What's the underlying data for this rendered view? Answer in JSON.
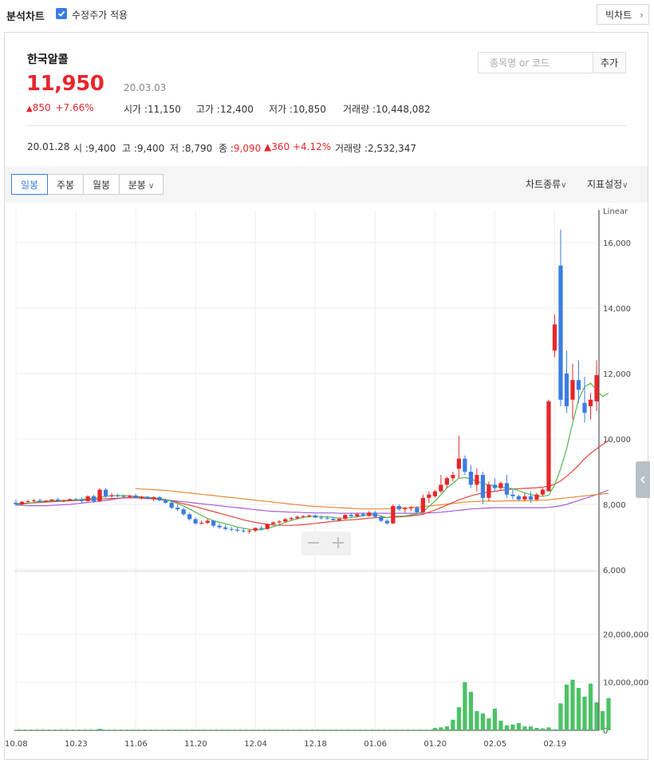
{
  "header": {
    "title": "분석차트",
    "adjusted_label": "수정주가 적용",
    "adjusted_checked": true,
    "big_chart_label": "빅차트"
  },
  "stock": {
    "name": "한국알콜",
    "price": "11,950",
    "date": "20.03.03",
    "change": "850",
    "change_pct": "+7.66%",
    "open_label": "시가 :",
    "open": "11,150",
    "high_label": "고가 :",
    "high": "12,400",
    "low_label": "저가 :",
    "low": "10,850",
    "volume_label": "거래량 :",
    "volume": "10,448,082"
  },
  "search": {
    "placeholder": "종목명 or 코드",
    "add_label": "추가"
  },
  "prev_day": {
    "date": "20.01.28",
    "open_label": "시 :",
    "open": "9,400",
    "high_label": "고 :",
    "high": "9,400",
    "low_label": "저 :",
    "low": "8,790",
    "close_label": "종 :",
    "close": "9,090",
    "change": "360",
    "change_pct": "+4.12%",
    "volume_label": "거래량 :",
    "volume": "2,532,347"
  },
  "toolbar": {
    "periods": [
      "일봉",
      "주봉",
      "월봉",
      "분봉"
    ],
    "chart_type_label": "차트종류",
    "indicator_label": "지표설정"
  },
  "chart_data": {
    "type": "candlestick",
    "scale": "Linear",
    "scale_label": "Linear",
    "price_ticks": [
      "16,000",
      "14,000",
      "12,000",
      "10,000",
      "8,000",
      "6,000"
    ],
    "price_tick_values": [
      16000,
      14000,
      12000,
      10000,
      8000,
      6000
    ],
    "ylim": [
      6000,
      17000
    ],
    "volume_ticks": [
      "20,000,000",
      "10,000,000",
      "0"
    ],
    "volume_tick_values": [
      20000000,
      10000000,
      0
    ],
    "volume_ylim": [
      0,
      31000000
    ],
    "x_ticks": [
      "10.08",
      "10.23",
      "11.06",
      "11.20",
      "12.04",
      "12.18",
      "01.06",
      "01.20",
      "02.05",
      "02.19"
    ],
    "x_tick_index": [
      0,
      10,
      20,
      30,
      40,
      50,
      60,
      70,
      80,
      90
    ],
    "colors": {
      "up": "#e8262b",
      "down": "#3a7de0",
      "volume": "#4cc266",
      "ma5": "#52b84f",
      "ma20": "#e0453c",
      "ma60": "#e98a36",
      "ma120": "#a55ed8"
    },
    "candles": [
      {
        "o": 8050,
        "h": 8150,
        "l": 7950,
        "c": 8000
      },
      {
        "o": 8000,
        "h": 8100,
        "l": 7980,
        "c": 8080
      },
      {
        "o": 8080,
        "h": 8150,
        "l": 8050,
        "c": 8100
      },
      {
        "o": 8100,
        "h": 8160,
        "l": 8080,
        "c": 8120
      },
      {
        "o": 8120,
        "h": 8180,
        "l": 8070,
        "c": 8090
      },
      {
        "o": 8090,
        "h": 8130,
        "l": 8060,
        "c": 8110
      },
      {
        "o": 8110,
        "h": 8160,
        "l": 8090,
        "c": 8150
      },
      {
        "o": 8150,
        "h": 8200,
        "l": 8080,
        "c": 8100
      },
      {
        "o": 8100,
        "h": 8150,
        "l": 8070,
        "c": 8120
      },
      {
        "o": 8120,
        "h": 8180,
        "l": 8100,
        "c": 8160
      },
      {
        "o": 8160,
        "h": 8200,
        "l": 8120,
        "c": 8150
      },
      {
        "o": 8150,
        "h": 8220,
        "l": 8050,
        "c": 8100
      },
      {
        "o": 8100,
        "h": 8280,
        "l": 8090,
        "c": 8250
      },
      {
        "o": 8250,
        "h": 8300,
        "l": 8050,
        "c": 8100
      },
      {
        "o": 8100,
        "h": 8500,
        "l": 8080,
        "c": 8450
      },
      {
        "o": 8450,
        "h": 8500,
        "l": 8200,
        "c": 8250
      },
      {
        "o": 8250,
        "h": 8350,
        "l": 8200,
        "c": 8280
      },
      {
        "o": 8280,
        "h": 8330,
        "l": 8220,
        "c": 8250
      },
      {
        "o": 8250,
        "h": 8300,
        "l": 8200,
        "c": 8230
      },
      {
        "o": 8230,
        "h": 8290,
        "l": 8200,
        "c": 8270
      },
      {
        "o": 8270,
        "h": 8320,
        "l": 8180,
        "c": 8200
      },
      {
        "o": 8200,
        "h": 8260,
        "l": 8150,
        "c": 8230
      },
      {
        "o": 8230,
        "h": 8260,
        "l": 8150,
        "c": 8180
      },
      {
        "o": 8180,
        "h": 8250,
        "l": 8100,
        "c": 8220
      },
      {
        "o": 8220,
        "h": 8250,
        "l": 8100,
        "c": 8120
      },
      {
        "o": 8120,
        "h": 8180,
        "l": 8020,
        "c": 8050
      },
      {
        "o": 8050,
        "h": 8100,
        "l": 7850,
        "c": 7900
      },
      {
        "o": 7900,
        "h": 8000,
        "l": 7800,
        "c": 7850
      },
      {
        "o": 7850,
        "h": 7900,
        "l": 7650,
        "c": 7700
      },
      {
        "o": 7700,
        "h": 7750,
        "l": 7500,
        "c": 7550
      },
      {
        "o": 7550,
        "h": 7600,
        "l": 7380,
        "c": 7420
      },
      {
        "o": 7420,
        "h": 7500,
        "l": 7380,
        "c": 7440
      },
      {
        "o": 7440,
        "h": 7550,
        "l": 7400,
        "c": 7500
      },
      {
        "o": 7500,
        "h": 7530,
        "l": 7300,
        "c": 7350
      },
      {
        "o": 7350,
        "h": 7420,
        "l": 7250,
        "c": 7300
      },
      {
        "o": 7300,
        "h": 7380,
        "l": 7200,
        "c": 7250
      },
      {
        "o": 7250,
        "h": 7320,
        "l": 7180,
        "c": 7230
      },
      {
        "o": 7230,
        "h": 7300,
        "l": 7150,
        "c": 7200
      },
      {
        "o": 7200,
        "h": 7280,
        "l": 7130,
        "c": 7180
      },
      {
        "o": 7180,
        "h": 7250,
        "l": 7100,
        "c": 7200
      },
      {
        "o": 7200,
        "h": 7300,
        "l": 7150,
        "c": 7280
      },
      {
        "o": 7280,
        "h": 7350,
        "l": 7200,
        "c": 7250
      },
      {
        "o": 7250,
        "h": 7420,
        "l": 7230,
        "c": 7400
      },
      {
        "o": 7400,
        "h": 7480,
        "l": 7350,
        "c": 7450
      },
      {
        "o": 7450,
        "h": 7520,
        "l": 7400,
        "c": 7480
      },
      {
        "o": 7480,
        "h": 7580,
        "l": 7450,
        "c": 7550
      },
      {
        "o": 7550,
        "h": 7620,
        "l": 7500,
        "c": 7580
      },
      {
        "o": 7580,
        "h": 7660,
        "l": 7540,
        "c": 7620
      },
      {
        "o": 7620,
        "h": 7680,
        "l": 7580,
        "c": 7640
      },
      {
        "o": 7640,
        "h": 7700,
        "l": 7600,
        "c": 7660
      },
      {
        "o": 7660,
        "h": 7700,
        "l": 7580,
        "c": 7600
      },
      {
        "o": 7600,
        "h": 7660,
        "l": 7540,
        "c": 7580
      },
      {
        "o": 7580,
        "h": 7650,
        "l": 7540,
        "c": 7560
      },
      {
        "o": 7560,
        "h": 7620,
        "l": 7500,
        "c": 7520
      },
      {
        "o": 7520,
        "h": 7600,
        "l": 7480,
        "c": 7560
      },
      {
        "o": 7560,
        "h": 7700,
        "l": 7540,
        "c": 7680
      },
      {
        "o": 7680,
        "h": 7720,
        "l": 7620,
        "c": 7640
      },
      {
        "o": 7640,
        "h": 7750,
        "l": 7600,
        "c": 7700
      },
      {
        "o": 7700,
        "h": 7760,
        "l": 7620,
        "c": 7650
      },
      {
        "o": 7650,
        "h": 7800,
        "l": 7620,
        "c": 7750
      },
      {
        "o": 7750,
        "h": 7800,
        "l": 7600,
        "c": 7620
      },
      {
        "o": 7620,
        "h": 7650,
        "l": 7450,
        "c": 7500
      },
      {
        "o": 7500,
        "h": 7550,
        "l": 7380,
        "c": 7420
      },
      {
        "o": 7420,
        "h": 8000,
        "l": 7400,
        "c": 7950
      },
      {
        "o": 7950,
        "h": 8000,
        "l": 7800,
        "c": 7850
      },
      {
        "o": 7850,
        "h": 7920,
        "l": 7750,
        "c": 7880
      },
      {
        "o": 7880,
        "h": 7950,
        "l": 7800,
        "c": 7900
      },
      {
        "o": 7900,
        "h": 7950,
        "l": 7720,
        "c": 7760
      },
      {
        "o": 7760,
        "h": 8300,
        "l": 7740,
        "c": 8200
      },
      {
        "o": 8200,
        "h": 8400,
        "l": 8050,
        "c": 8300
      },
      {
        "o": 8250,
        "h": 8450,
        "l": 8200,
        "c": 8400
      },
      {
        "o": 8400,
        "h": 8900,
        "l": 8350,
        "c": 8600
      },
      {
        "o": 8600,
        "h": 8850,
        "l": 8500,
        "c": 8800
      },
      {
        "o": 8800,
        "h": 9000,
        "l": 8700,
        "c": 8900
      },
      {
        "o": 9090,
        "h": 10100,
        "l": 8790,
        "c": 9400
      },
      {
        "o": 9400,
        "h": 9500,
        "l": 8900,
        "c": 9000
      },
      {
        "o": 9000,
        "h": 9200,
        "l": 8500,
        "c": 8600
      },
      {
        "o": 8600,
        "h": 9100,
        "l": 8400,
        "c": 8900
      },
      {
        "o": 8900,
        "h": 9000,
        "l": 8000,
        "c": 8200
      },
      {
        "o": 8200,
        "h": 8700,
        "l": 8100,
        "c": 8600
      },
      {
        "o": 8600,
        "h": 8800,
        "l": 8400,
        "c": 8500
      },
      {
        "o": 8500,
        "h": 8700,
        "l": 8450,
        "c": 8650
      },
      {
        "o": 8650,
        "h": 8900,
        "l": 8200,
        "c": 8300
      },
      {
        "o": 8300,
        "h": 8450,
        "l": 8150,
        "c": 8250
      },
      {
        "o": 8250,
        "h": 8300,
        "l": 8100,
        "c": 8150
      },
      {
        "o": 8150,
        "h": 8350,
        "l": 8100,
        "c": 8250
      },
      {
        "o": 8250,
        "h": 8400,
        "l": 8050,
        "c": 8150
      },
      {
        "o": 8150,
        "h": 8350,
        "l": 8120,
        "c": 8300
      },
      {
        "o": 8300,
        "h": 8500,
        "l": 8250,
        "c": 8450
      },
      {
        "o": 8400,
        "h": 11200,
        "l": 8400,
        "c": 11150
      },
      {
        "o": 12700,
        "h": 13800,
        "l": 12500,
        "c": 13500
      },
      {
        "o": 15300,
        "h": 16400,
        "l": 11000,
        "c": 11200
      },
      {
        "o": 12000,
        "h": 12700,
        "l": 10800,
        "c": 11000
      },
      {
        "o": 11200,
        "h": 12300,
        "l": 10600,
        "c": 11800
      },
      {
        "o": 11800,
        "h": 12400,
        "l": 11100,
        "c": 11500
      },
      {
        "o": 11100,
        "h": 11900,
        "l": 10500,
        "c": 10800
      },
      {
        "o": 11000,
        "h": 11400,
        "l": 10600,
        "c": 11200
      },
      {
        "o": 11150,
        "h": 12400,
        "l": 10850,
        "c": 11950
      }
    ],
    "volumes": [
      1,
      1,
      1,
      1,
      1,
      1,
      1,
      1,
      1,
      1,
      1,
      1,
      1,
      1,
      3,
      1,
      1,
      1,
      1,
      1,
      1,
      1,
      1,
      1,
      1,
      1,
      1,
      1,
      1,
      1,
      1,
      1,
      1,
      1,
      1,
      1,
      1,
      1,
      1,
      1,
      1,
      1,
      1,
      1,
      1,
      1,
      1,
      1,
      1,
      1,
      1,
      1,
      1,
      1,
      1,
      1,
      1,
      1,
      1,
      1,
      1,
      1,
      1,
      1,
      1,
      1,
      1,
      1,
      1,
      1,
      5,
      6,
      8,
      22,
      48,
      100,
      80,
      40,
      35,
      25,
      45,
      20,
      10,
      12,
      15,
      8,
      8,
      5,
      4,
      6,
      2,
      56,
      95,
      105,
      88,
      70,
      97,
      58,
      40,
      67
    ],
    "volume_unit": 100000,
    "ma5": [
      8000,
      8010,
      8030,
      8060,
      8090,
      8100,
      8110,
      8120,
      8120,
      8130,
      8140,
      8150,
      8170,
      8180,
      8210,
      8250,
      8260,
      8270,
      8270,
      8260,
      8250,
      8230,
      8220,
      8200,
      8180,
      8150,
      8090,
      8030,
      7950,
      7860,
      7760,
      7660,
      7570,
      7500,
      7450,
      7410,
      7360,
      7310,
      7270,
      7240,
      7230,
      7230,
      7270,
      7320,
      7380,
      7450,
      7510,
      7560,
      7600,
      7630,
      7640,
      7630,
      7620,
      7600,
      7580,
      7580,
      7600,
      7620,
      7660,
      7680,
      7680,
      7650,
      7590,
      7640,
      7640,
      7650,
      7680,
      7710,
      7780,
      7940,
      8100,
      8300,
      8500,
      8650,
      8800,
      8820,
      8780,
      8700,
      8640,
      8600,
      8560,
      8520,
      8500,
      8480,
      8420,
      8350,
      8300,
      8260,
      8250,
      8280,
      8600,
      9100,
      9700,
      10500,
      11200,
      11600,
      11700,
      11500,
      11300,
      11400
    ],
    "ma20": [
      8020,
      8030,
      8040,
      8050,
      8060,
      8070,
      8080,
      8090,
      8100,
      8110,
      8120,
      8130,
      8140,
      8150,
      8160,
      8170,
      8180,
      8190,
      8200,
      8200,
      8200,
      8190,
      8180,
      8170,
      8150,
      8130,
      8100,
      8060,
      8020,
      7980,
      7930,
      7880,
      7830,
      7780,
      7730,
      7680,
      7630,
      7580,
      7530,
      7490,
      7450,
      7420,
      7390,
      7370,
      7360,
      7360,
      7360,
      7370,
      7380,
      7400,
      7420,
      7440,
      7460,
      7480,
      7500,
      7520,
      7530,
      7540,
      7560,
      7580,
      7590,
      7600,
      7600,
      7610,
      7620,
      7630,
      7650,
      7670,
      7700,
      7760,
      7830,
      7900,
      7980,
      8060,
      8140,
      8200,
      8260,
      8310,
      8350,
      8380,
      8400,
      8430,
      8450,
      8470,
      8480,
      8490,
      8500,
      8510,
      8530,
      8560,
      8620,
      8720,
      8860,
      9020,
      9200,
      9400,
      9560,
      9700,
      9830,
      9950
    ],
    "ma60": [
      null,
      null,
      null,
      null,
      null,
      null,
      null,
      null,
      null,
      null,
      null,
      null,
      null,
      null,
      null,
      null,
      null,
      null,
      null,
      null,
      8480,
      8470,
      8460,
      8450,
      8440,
      8430,
      8410,
      8390,
      8370,
      8350,
      8330,
      8310,
      8290,
      8270,
      8250,
      8230,
      8210,
      8190,
      8170,
      8150,
      8130,
      8110,
      8090,
      8070,
      8050,
      8030,
      8010,
      7990,
      7970,
      7950,
      7940,
      7930,
      7920,
      7910,
      7900,
      7890,
      7880,
      7870,
      7860,
      7860,
      7860,
      7860,
      7870,
      7880,
      7890,
      7900,
      7910,
      7920,
      7930,
      7950,
      7970,
      7990,
      8010,
      8030,
      8050,
      8070,
      8080,
      8090,
      8100,
      8100,
      8100,
      8100,
      8110,
      8110,
      8110,
      8110,
      8120,
      8120,
      8130,
      8140,
      8160,
      8180,
      8200,
      8220,
      8240,
      8260,
      8280,
      8300,
      8320,
      8340
    ],
    "ma120": [
      7980,
      7970,
      7960,
      7960,
      7960,
      7960,
      7970,
      7980,
      7990,
      8000,
      8020,
      8040,
      8060,
      8080,
      8100,
      8120,
      8150,
      8180,
      8200,
      8210,
      8220,
      8210,
      8200,
      8180,
      8160,
      8140,
      8120,
      8100,
      8080,
      8060,
      8040,
      8020,
      8000,
      7980,
      7960,
      7940,
      7920,
      7900,
      7880,
      7860,
      7840,
      7820,
      7800,
      7790,
      7780,
      7770,
      7760,
      7760,
      7750,
      7750,
      7740,
      7740,
      7740,
      7740,
      7730,
      7730,
      7730,
      7730,
      7730,
      7730,
      7730,
      7730,
      7730,
      7730,
      7730,
      7730,
      7730,
      7730,
      7730,
      7740,
      7750,
      7760,
      7780,
      7800,
      7820,
      7840,
      7860,
      7870,
      7880,
      7890,
      7900,
      7900,
      7900,
      7900,
      7900,
      7900,
      7900,
      7900,
      7900,
      7910,
      7930,
      7960,
      8000,
      8060,
      8120,
      8180,
      8240,
      8300,
      8370,
      8440
    ]
  }
}
